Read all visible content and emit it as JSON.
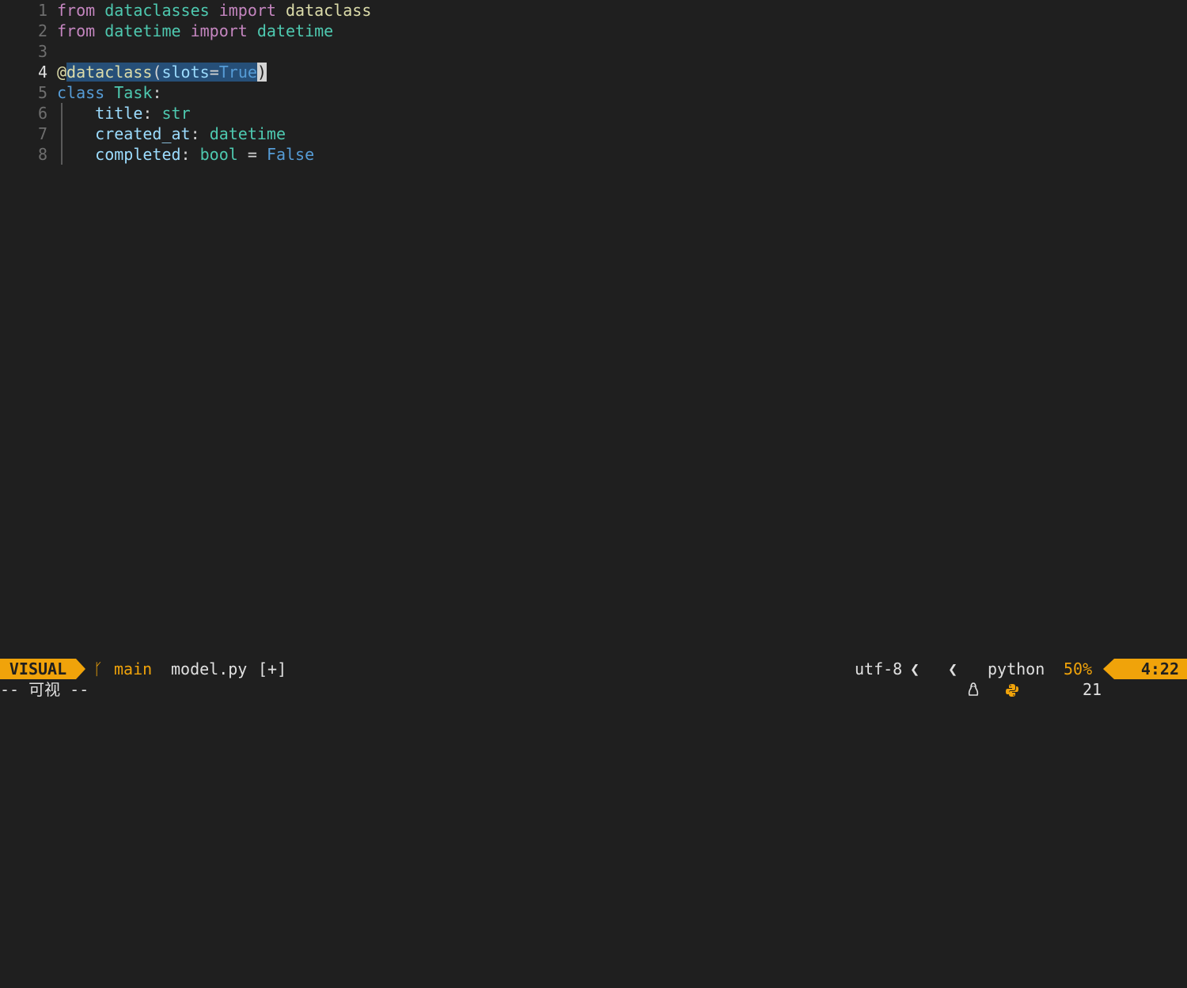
{
  "editor": {
    "line_numbers": [
      "1",
      "2",
      "3",
      "4",
      "5",
      "6",
      "7",
      "8"
    ],
    "current_line": "4",
    "lines": [
      [
        {
          "t": "from",
          "c": "kw"
        },
        {
          "t": " ",
          "c": "plain"
        },
        {
          "t": "dataclasses",
          "c": "mod"
        },
        {
          "t": " ",
          "c": "plain"
        },
        {
          "t": "import",
          "c": "kw"
        },
        {
          "t": " ",
          "c": "plain"
        },
        {
          "t": "dataclass",
          "c": "fn"
        }
      ],
      [
        {
          "t": "from",
          "c": "kw"
        },
        {
          "t": " ",
          "c": "plain"
        },
        {
          "t": "datetime",
          "c": "mod"
        },
        {
          "t": " ",
          "c": "plain"
        },
        {
          "t": "import",
          "c": "kw"
        },
        {
          "t": " ",
          "c": "plain"
        },
        {
          "t": "datetime",
          "c": "mod"
        }
      ],
      [],
      [
        {
          "t": "@",
          "c": "deco"
        },
        {
          "t": "dataclass",
          "c": "fn sel"
        },
        {
          "t": "(",
          "c": "plain sel"
        },
        {
          "t": "slots",
          "c": "attr sel"
        },
        {
          "t": "=",
          "c": "plain sel"
        },
        {
          "t": "True",
          "c": "const sel"
        },
        {
          "t": ")",
          "c": "cursor"
        }
      ],
      [
        {
          "t": "class",
          "c": "kw2"
        },
        {
          "t": " ",
          "c": "plain"
        },
        {
          "t": "Task",
          "c": "cls"
        },
        {
          "t": ":",
          "c": "plain"
        }
      ],
      [
        {
          "t": "    ",
          "c": "plain"
        },
        {
          "t": "title",
          "c": "attr"
        },
        {
          "t": ": ",
          "c": "plain"
        },
        {
          "t": "str",
          "c": "type"
        }
      ],
      [
        {
          "t": "    ",
          "c": "plain"
        },
        {
          "t": "created_at",
          "c": "attr"
        },
        {
          "t": ": ",
          "c": "plain"
        },
        {
          "t": "datetime",
          "c": "type"
        }
      ],
      [
        {
          "t": "    ",
          "c": "plain"
        },
        {
          "t": "completed",
          "c": "attr"
        },
        {
          "t": ": ",
          "c": "plain"
        },
        {
          "t": "bool",
          "c": "type"
        },
        {
          "t": " = ",
          "c": "plain"
        },
        {
          "t": "False",
          "c": "const"
        }
      ]
    ]
  },
  "statusline": {
    "mode": "VISUAL",
    "branch_icon": "git-branch-icon",
    "branch": "main",
    "filename": "model.py",
    "modified": "[+]",
    "encoding": "utf-8",
    "separator": "❮",
    "os_icon": "linux-icon",
    "filetype_icon": "python-icon",
    "filetype": "python",
    "percent": "50%",
    "position": "4:22",
    "accent_color": "#f0a30a"
  },
  "cmdline": {
    "message": "-- 可视 --",
    "selection_count": "21"
  }
}
